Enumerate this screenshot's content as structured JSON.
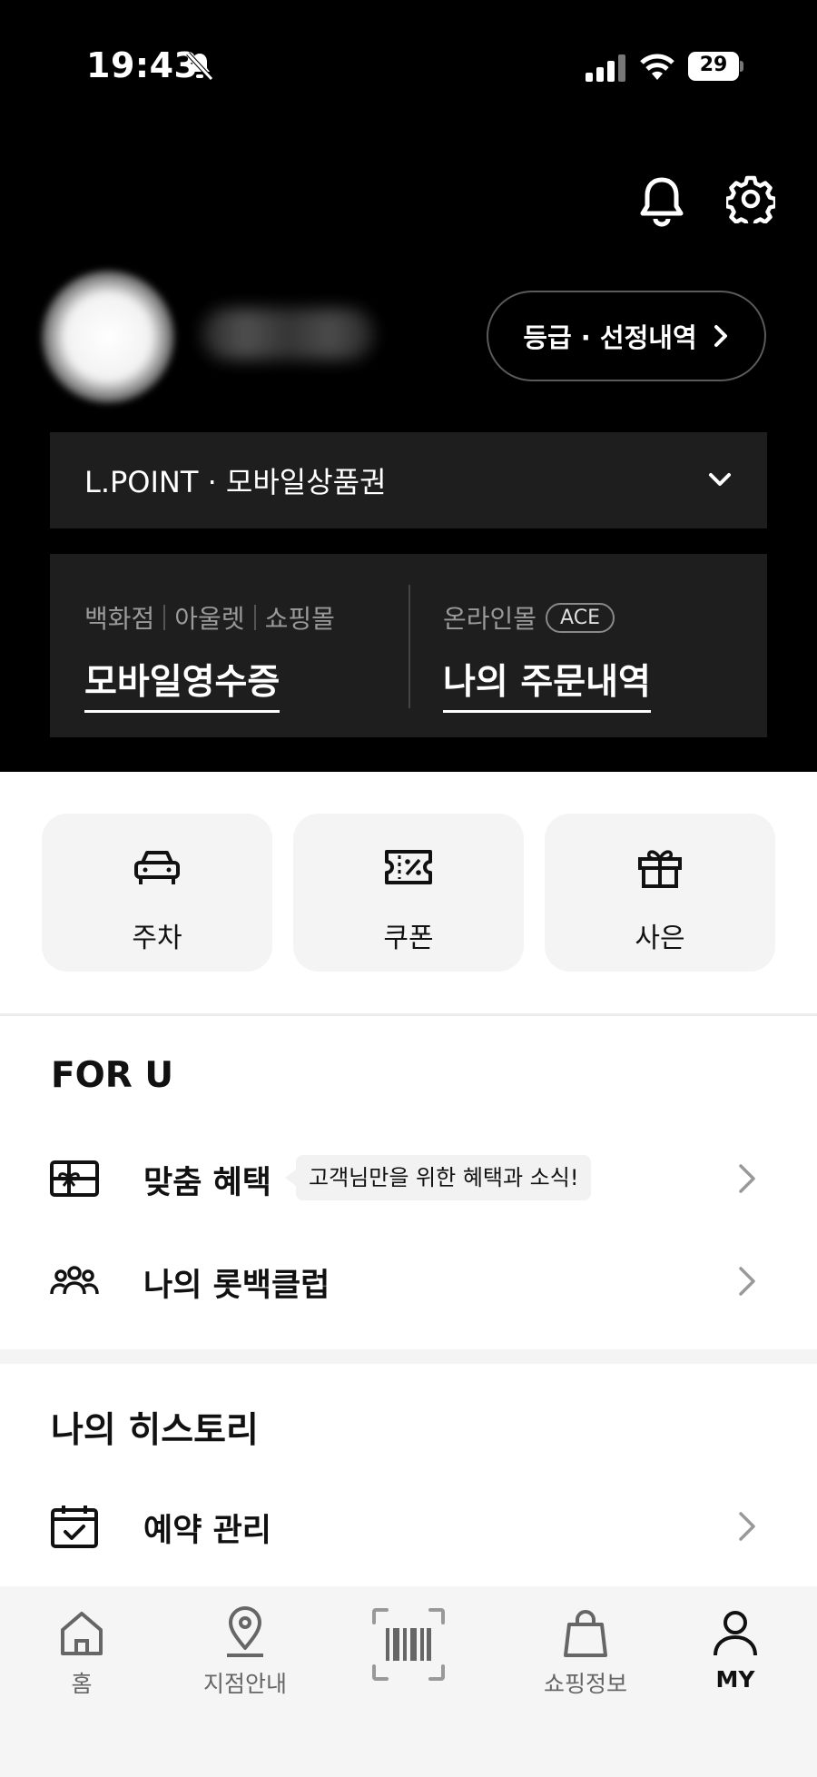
{
  "status_bar": {
    "time": "19:43",
    "battery": "29"
  },
  "header": {
    "grade_button_label": "등급 · 선정내역",
    "lpoint_label": "L.POINT · 모바일상품권"
  },
  "receipts": {
    "left": {
      "categories": [
        "백화점",
        "아울렛",
        "쇼핑몰"
      ],
      "link": "모바일영수증"
    },
    "right": {
      "category": "온라인몰",
      "badge": "ACE",
      "link": "나의 주문내역"
    }
  },
  "quick_menu": [
    {
      "label": "주차",
      "icon": "car-icon"
    },
    {
      "label": "쿠폰",
      "icon": "coupon-icon"
    },
    {
      "label": "사은",
      "icon": "gift-icon"
    }
  ],
  "for_u": {
    "title": "FOR U",
    "items": [
      {
        "label": "맞춤 혜택",
        "icon": "benefit-card-icon",
        "tooltip": "고객님만을 위한 혜택과 소식!"
      },
      {
        "label": "나의 롯백클럽",
        "icon": "group-icon"
      }
    ]
  },
  "history": {
    "title": "나의 히스토리",
    "items": [
      {
        "label": "예약 관리",
        "icon": "calendar-check-icon"
      }
    ]
  },
  "bottom_nav": [
    {
      "label": "홈",
      "icon": "home-icon"
    },
    {
      "label": "지점안내",
      "icon": "location-pin-icon"
    },
    {
      "label": "",
      "icon": "barcode-scan-icon"
    },
    {
      "label": "쇼핑정보",
      "icon": "shopping-bag-icon"
    },
    {
      "label": "MY",
      "icon": "person-icon",
      "active": true
    }
  ]
}
